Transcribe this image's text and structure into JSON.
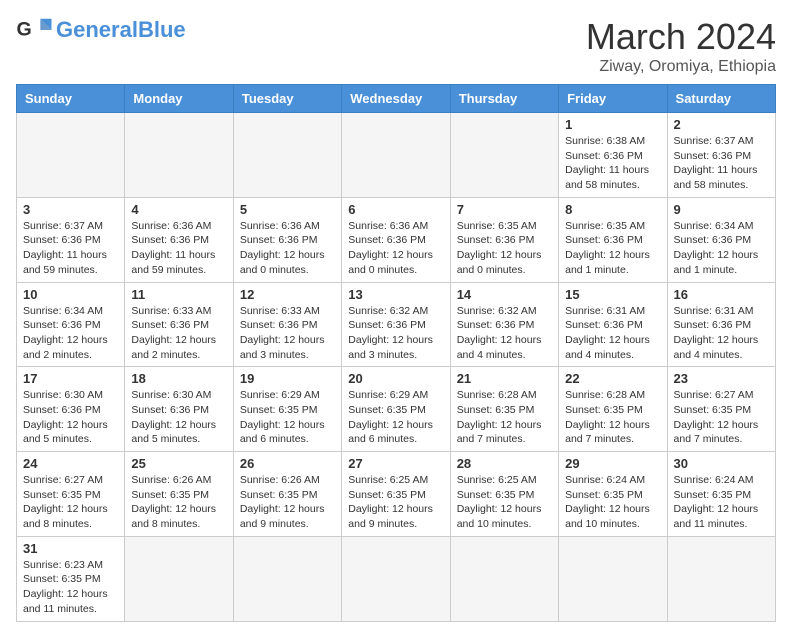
{
  "header": {
    "logo_general": "General",
    "logo_blue": "Blue",
    "title": "March 2024",
    "subtitle": "Ziway, Oromiya, Ethiopia"
  },
  "weekdays": [
    "Sunday",
    "Monday",
    "Tuesday",
    "Wednesday",
    "Thursday",
    "Friday",
    "Saturday"
  ],
  "weeks": [
    [
      {
        "day": "",
        "info": "",
        "empty": true
      },
      {
        "day": "",
        "info": "",
        "empty": true
      },
      {
        "day": "",
        "info": "",
        "empty": true
      },
      {
        "day": "",
        "info": "",
        "empty": true
      },
      {
        "day": "",
        "info": "",
        "empty": true
      },
      {
        "day": "1",
        "info": "Sunrise: 6:38 AM\nSunset: 6:36 PM\nDaylight: 11 hours and 58 minutes.",
        "empty": false
      },
      {
        "day": "2",
        "info": "Sunrise: 6:37 AM\nSunset: 6:36 PM\nDaylight: 11 hours and 58 minutes.",
        "empty": false
      }
    ],
    [
      {
        "day": "3",
        "info": "Sunrise: 6:37 AM\nSunset: 6:36 PM\nDaylight: 11 hours and 59 minutes.",
        "empty": false
      },
      {
        "day": "4",
        "info": "Sunrise: 6:36 AM\nSunset: 6:36 PM\nDaylight: 11 hours and 59 minutes.",
        "empty": false
      },
      {
        "day": "5",
        "info": "Sunrise: 6:36 AM\nSunset: 6:36 PM\nDaylight: 12 hours and 0 minutes.",
        "empty": false
      },
      {
        "day": "6",
        "info": "Sunrise: 6:36 AM\nSunset: 6:36 PM\nDaylight: 12 hours and 0 minutes.",
        "empty": false
      },
      {
        "day": "7",
        "info": "Sunrise: 6:35 AM\nSunset: 6:36 PM\nDaylight: 12 hours and 0 minutes.",
        "empty": false
      },
      {
        "day": "8",
        "info": "Sunrise: 6:35 AM\nSunset: 6:36 PM\nDaylight: 12 hours and 1 minute.",
        "empty": false
      },
      {
        "day": "9",
        "info": "Sunrise: 6:34 AM\nSunset: 6:36 PM\nDaylight: 12 hours and 1 minute.",
        "empty": false
      }
    ],
    [
      {
        "day": "10",
        "info": "Sunrise: 6:34 AM\nSunset: 6:36 PM\nDaylight: 12 hours and 2 minutes.",
        "empty": false
      },
      {
        "day": "11",
        "info": "Sunrise: 6:33 AM\nSunset: 6:36 PM\nDaylight: 12 hours and 2 minutes.",
        "empty": false
      },
      {
        "day": "12",
        "info": "Sunrise: 6:33 AM\nSunset: 6:36 PM\nDaylight: 12 hours and 3 minutes.",
        "empty": false
      },
      {
        "day": "13",
        "info": "Sunrise: 6:32 AM\nSunset: 6:36 PM\nDaylight: 12 hours and 3 minutes.",
        "empty": false
      },
      {
        "day": "14",
        "info": "Sunrise: 6:32 AM\nSunset: 6:36 PM\nDaylight: 12 hours and 4 minutes.",
        "empty": false
      },
      {
        "day": "15",
        "info": "Sunrise: 6:31 AM\nSunset: 6:36 PM\nDaylight: 12 hours and 4 minutes.",
        "empty": false
      },
      {
        "day": "16",
        "info": "Sunrise: 6:31 AM\nSunset: 6:36 PM\nDaylight: 12 hours and 4 minutes.",
        "empty": false
      }
    ],
    [
      {
        "day": "17",
        "info": "Sunrise: 6:30 AM\nSunset: 6:36 PM\nDaylight: 12 hours and 5 minutes.",
        "empty": false
      },
      {
        "day": "18",
        "info": "Sunrise: 6:30 AM\nSunset: 6:36 PM\nDaylight: 12 hours and 5 minutes.",
        "empty": false
      },
      {
        "day": "19",
        "info": "Sunrise: 6:29 AM\nSunset: 6:35 PM\nDaylight: 12 hours and 6 minutes.",
        "empty": false
      },
      {
        "day": "20",
        "info": "Sunrise: 6:29 AM\nSunset: 6:35 PM\nDaylight: 12 hours and 6 minutes.",
        "empty": false
      },
      {
        "day": "21",
        "info": "Sunrise: 6:28 AM\nSunset: 6:35 PM\nDaylight: 12 hours and 7 minutes.",
        "empty": false
      },
      {
        "day": "22",
        "info": "Sunrise: 6:28 AM\nSunset: 6:35 PM\nDaylight: 12 hours and 7 minutes.",
        "empty": false
      },
      {
        "day": "23",
        "info": "Sunrise: 6:27 AM\nSunset: 6:35 PM\nDaylight: 12 hours and 7 minutes.",
        "empty": false
      }
    ],
    [
      {
        "day": "24",
        "info": "Sunrise: 6:27 AM\nSunset: 6:35 PM\nDaylight: 12 hours and 8 minutes.",
        "empty": false
      },
      {
        "day": "25",
        "info": "Sunrise: 6:26 AM\nSunset: 6:35 PM\nDaylight: 12 hours and 8 minutes.",
        "empty": false
      },
      {
        "day": "26",
        "info": "Sunrise: 6:26 AM\nSunset: 6:35 PM\nDaylight: 12 hours and 9 minutes.",
        "empty": false
      },
      {
        "day": "27",
        "info": "Sunrise: 6:25 AM\nSunset: 6:35 PM\nDaylight: 12 hours and 9 minutes.",
        "empty": false
      },
      {
        "day": "28",
        "info": "Sunrise: 6:25 AM\nSunset: 6:35 PM\nDaylight: 12 hours and 10 minutes.",
        "empty": false
      },
      {
        "day": "29",
        "info": "Sunrise: 6:24 AM\nSunset: 6:35 PM\nDaylight: 12 hours and 10 minutes.",
        "empty": false
      },
      {
        "day": "30",
        "info": "Sunrise: 6:24 AM\nSunset: 6:35 PM\nDaylight: 12 hours and 11 minutes.",
        "empty": false
      }
    ],
    [
      {
        "day": "31",
        "info": "Sunrise: 6:23 AM\nSunset: 6:35 PM\nDaylight: 12 hours and 11 minutes.",
        "empty": false
      },
      {
        "day": "",
        "info": "",
        "empty": true
      },
      {
        "day": "",
        "info": "",
        "empty": true
      },
      {
        "day": "",
        "info": "",
        "empty": true
      },
      {
        "day": "",
        "info": "",
        "empty": true
      },
      {
        "day": "",
        "info": "",
        "empty": true
      },
      {
        "day": "",
        "info": "",
        "empty": true
      }
    ]
  ]
}
